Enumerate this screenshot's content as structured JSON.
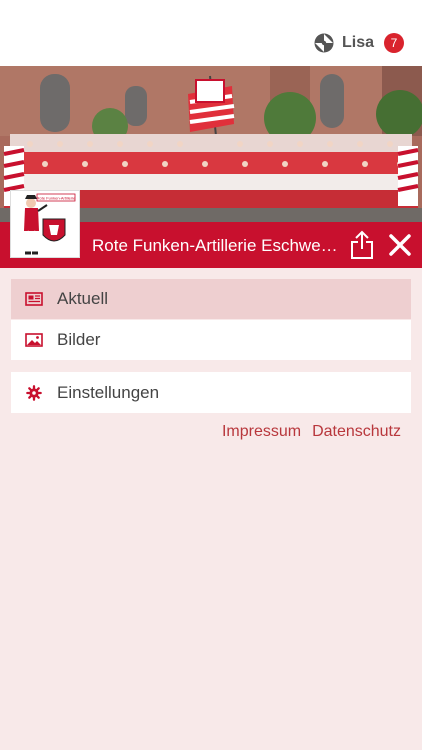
{
  "user": {
    "name": "Lisa",
    "badge_count": "7",
    "icon": "account-switch-icon"
  },
  "header": {
    "title": "Rote Funken-Artillerie Eschwe…"
  },
  "logo": {
    "text": "Rote Funken-Artillerie"
  },
  "menu_primary": [
    {
      "label": "Aktuell",
      "icon": "newspaper-icon",
      "active": true
    },
    {
      "label": "Bilder",
      "icon": "image-icon",
      "active": false
    }
  ],
  "menu_secondary": [
    {
      "label": "Einstellungen",
      "icon": "gear-icon"
    }
  ],
  "links": {
    "impressum": "Impressum",
    "datenschutz": "Datenschutz"
  },
  "colors": {
    "accent": "#c8102e",
    "background": "#f8e9e9",
    "active_item": "#eecfd0",
    "link": "#b8373c"
  }
}
